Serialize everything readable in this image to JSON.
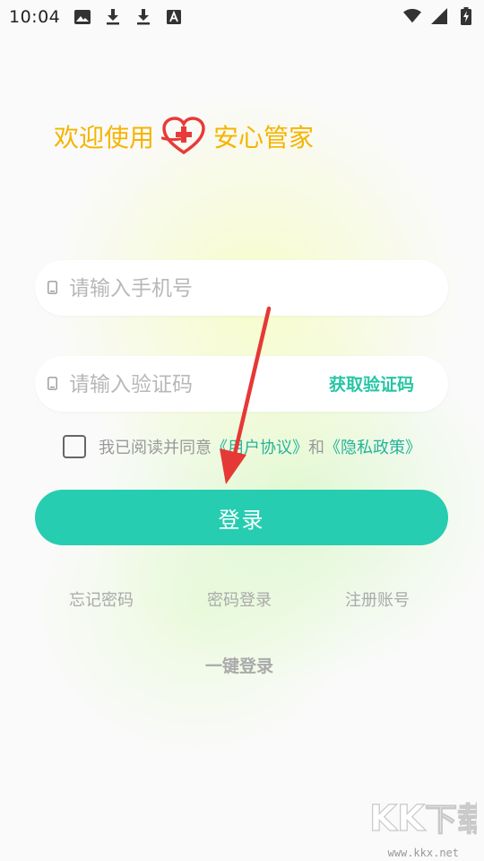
{
  "status_bar": {
    "time": "10:04",
    "left_icons": [
      "image-icon",
      "download-icon",
      "download-icon",
      "keyboard-a-icon"
    ],
    "right_icons": [
      "wifi-icon",
      "signal-icon",
      "battery-charging-icon"
    ]
  },
  "welcome": {
    "prefix": "欢迎使用",
    "app_name": "安心管家",
    "color": "#f5b400"
  },
  "phone_field": {
    "placeholder": "请输入手机号"
  },
  "code_field": {
    "placeholder": "请输入验证码",
    "get_code_label": "获取验证码"
  },
  "agreement": {
    "checked": false,
    "text_prefix": "我已阅读并同意",
    "user_agreement": "《用户协议》",
    "conjunction": "和",
    "privacy_policy": "《隐私政策》"
  },
  "login_button": {
    "label": "登录",
    "color": "#26cdb0"
  },
  "options": {
    "forgot_password": "忘记密码",
    "password_login": "密码登录",
    "register": "注册账号",
    "one_click_login": "一键登录"
  },
  "watermark": {
    "brand": "KK下载",
    "url": "www.kkx.net"
  },
  "colors": {
    "accent": "#26cdb0",
    "link": "#26b39a",
    "arrow": "#e53935"
  }
}
